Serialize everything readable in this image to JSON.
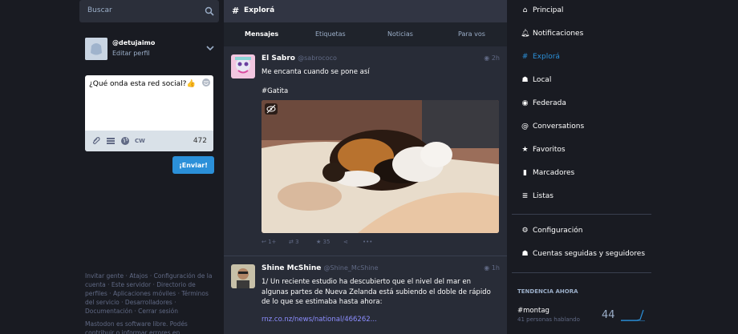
{
  "search": {
    "placeholder": "Buscar"
  },
  "profile": {
    "handle": "@detujaimo",
    "edit_label": "Editar perfil"
  },
  "composer": {
    "text": "¿Qué onda esta red social?👍",
    "cw_label": "CW",
    "char_count": "472",
    "send_label": "¡Enviar!"
  },
  "footer": {
    "links": "Invitar gente · Atajos · Configuración de la cuenta · Este servidor · Directorio de perfiles · Aplicaciones móviles · Términos del servicio · Desarrolladores · Documentación · Cerrar sesión",
    "notice": "Mastodon es software libre. Podés contribuir o informar errores en mastodon/mastodon"
  },
  "column": {
    "title": "Explorá",
    "tabs": [
      "Mensajes",
      "Etiquetas",
      "Noticias",
      "Para vos"
    ]
  },
  "statuses": [
    {
      "name": "El Sabro",
      "acct": "@sabrococo",
      "time": "2h",
      "text": "Me encanta cuando se pone así",
      "hashtag": "#Gatita",
      "replies": "1+",
      "boosts": "3",
      "favs": "35"
    },
    {
      "name": "Shine McShine",
      "acct": "@Shine_McShine",
      "time": "1h",
      "text": "1/ Un reciente estudio ha descubierto que el nivel del mar en algunas partes de Nueva Zelanda está subiendo el doble de rápido de lo que se estimaba hasta ahora:",
      "link": "rnz.co.nz/news/national/466262..."
    }
  ],
  "nav": {
    "items": [
      {
        "label": "Principal",
        "icon": "home-icon"
      },
      {
        "label": "Notificaciones",
        "icon": "bell-icon"
      },
      {
        "label": "Explorá",
        "icon": "hashtag-icon"
      },
      {
        "label": "Local",
        "icon": "users-icon"
      },
      {
        "label": "Federada",
        "icon": "globe-icon"
      },
      {
        "label": "Conversations",
        "icon": "at-icon"
      },
      {
        "label": "Favoritos",
        "icon": "star-icon"
      },
      {
        "label": "Marcadores",
        "icon": "bookmark-icon"
      },
      {
        "label": "Listas",
        "icon": "list-icon"
      },
      {
        "label": "Configuración",
        "icon": "gear-icon"
      },
      {
        "label": "Cuentas seguidas y seguidores",
        "icon": "users-icon"
      }
    ]
  },
  "trends": {
    "title": "TENDENCIA AHORA",
    "tag": "#montag",
    "people": "41 personas hablando",
    "count": "44"
  },
  "colors": {
    "accent": "#2b90d9",
    "bg": "#191b22",
    "column": "#282c37"
  }
}
